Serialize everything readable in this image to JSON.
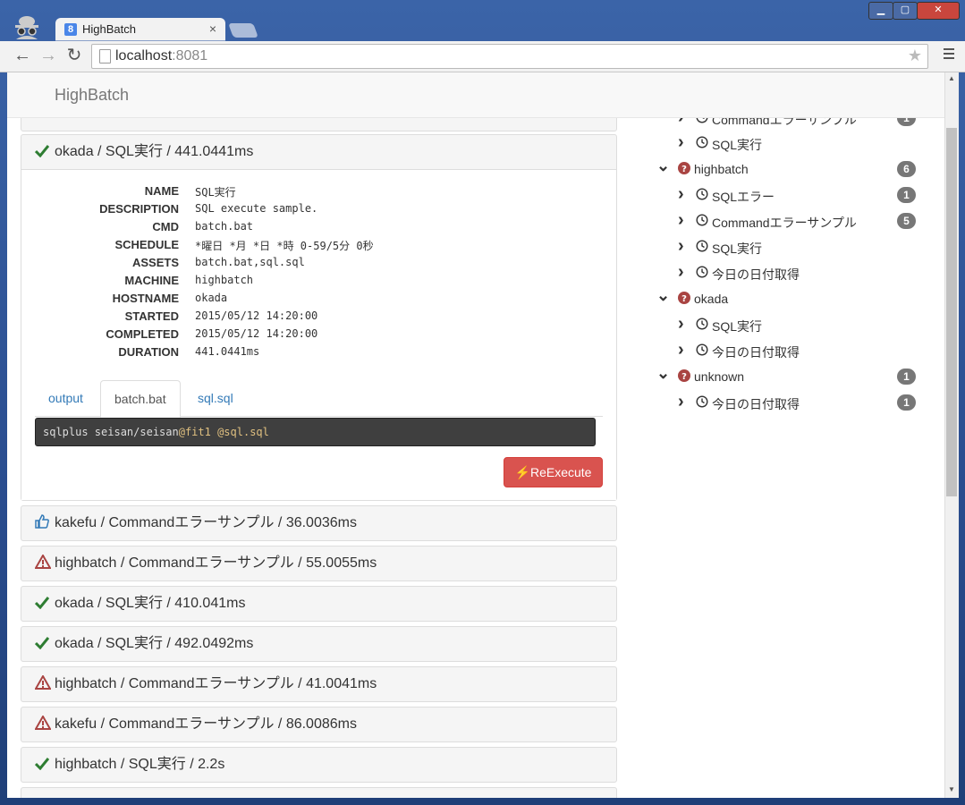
{
  "browser": {
    "tab_title": "HighBatch",
    "tab_favicon_letter": "8",
    "url_host": "localhost",
    "url_port": ":8081"
  },
  "app": {
    "brand": "HighBatch"
  },
  "detail": {
    "header": "okada / SQL実行 / 441.0441ms",
    "fields": [
      {
        "key": "NAME",
        "value": "SQL実行"
      },
      {
        "key": "DESCRIPTION",
        "value": "SQL execute sample."
      },
      {
        "key": "CMD",
        "value": "batch.bat"
      },
      {
        "key": "SCHEDULE",
        "value": "*曜日 *月 *日 *時 0-59/5分 0秒"
      },
      {
        "key": "ASSETS",
        "value": "batch.bat,sql.sql"
      },
      {
        "key": "MACHINE",
        "value": "highbatch"
      },
      {
        "key": "HOSTNAME",
        "value": "okada"
      },
      {
        "key": "STARTED",
        "value": "2015/05/12 14:20:00"
      },
      {
        "key": "COMPLETED",
        "value": "2015/05/12 14:20:00"
      },
      {
        "key": "DURATION",
        "value": "441.0441ms"
      }
    ],
    "tabs": [
      "output",
      "batch.bat",
      "sql.sql"
    ],
    "active_tab": "batch.bat",
    "code_parts": [
      "sqlplus seisan/seisan",
      "@fit1",
      "@sql.sql"
    ],
    "reexecute_label": "ReExecute"
  },
  "jobs": [
    {
      "status": "like",
      "text": "kakefu / Commandエラーサンプル / 36.0036ms"
    },
    {
      "status": "warning",
      "text": "highbatch / Commandエラーサンプル / 55.0055ms"
    },
    {
      "status": "ok",
      "text": "okada / SQL実行 / 410.041ms"
    },
    {
      "status": "ok",
      "text": "okada / SQL実行 / 492.0492ms"
    },
    {
      "status": "warning",
      "text": "highbatch / Commandエラーサンプル / 41.0041ms"
    },
    {
      "status": "warning",
      "text": "kakefu / Commandエラーサンプル / 86.0086ms"
    },
    {
      "status": "ok",
      "text": "highbatch / SQL実行 / 2.2s"
    }
  ],
  "tree": [
    {
      "level": 1,
      "label": "Commandエラーサンプル",
      "badge": "1"
    },
    {
      "level": 1,
      "label": "SQL実行",
      "badge": ""
    },
    {
      "level": 0,
      "label": "highbatch",
      "badge": "6"
    },
    {
      "level": 1,
      "label": "SQLエラー",
      "badge": "1"
    },
    {
      "level": 1,
      "label": "Commandエラーサンプル",
      "badge": "5"
    },
    {
      "level": 1,
      "label": "SQL実行",
      "badge": ""
    },
    {
      "level": 1,
      "label": "今日の日付取得",
      "badge": ""
    },
    {
      "level": 0,
      "label": "okada",
      "badge": ""
    },
    {
      "level": 1,
      "label": "SQL実行",
      "badge": ""
    },
    {
      "level": 1,
      "label": "今日の日付取得",
      "badge": ""
    },
    {
      "level": 0,
      "label": "unknown",
      "badge": "1"
    },
    {
      "level": 1,
      "label": "今日の日付取得",
      "badge": "1"
    }
  ],
  "colors": {
    "ok": "#2e7d32",
    "warning": "#a94442",
    "like": "#337ab7",
    "danger": "#d9534f"
  }
}
